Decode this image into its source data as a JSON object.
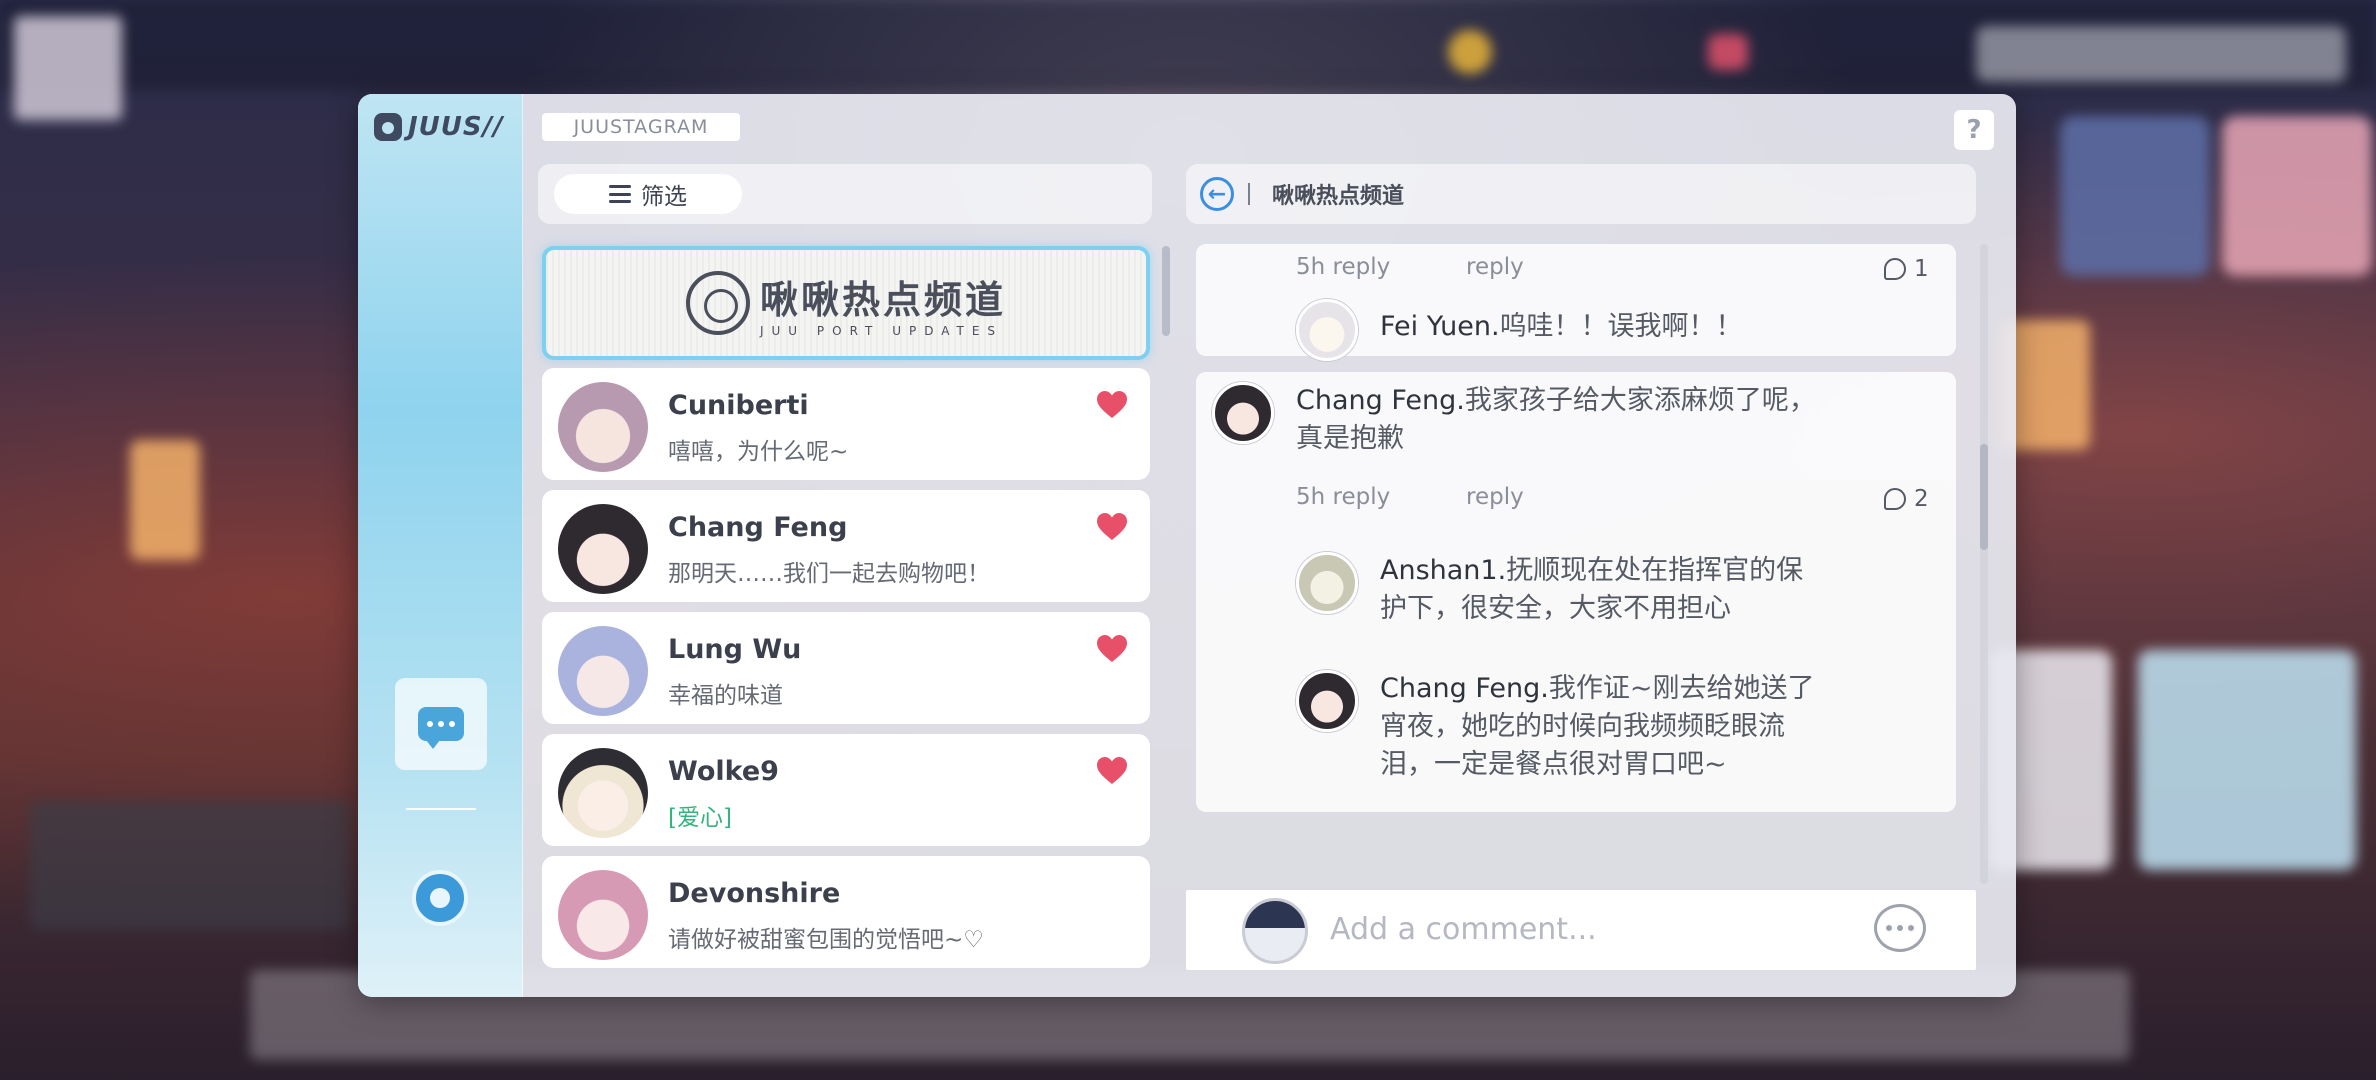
{
  "app": {
    "logo_text": "JUUS//",
    "tag": "JUUSTAGRAM",
    "help": "?"
  },
  "filter": {
    "label": "筛选"
  },
  "channel_card": {
    "title": "啾啾热点频道",
    "subtitle": "JUU PORT UPDATES"
  },
  "friends": [
    {
      "name": "Cuniberti",
      "message": "嘻嘻，为什么呢~",
      "liked": true,
      "avatar_color": "#b79ab0"
    },
    {
      "name": "Chang Feng",
      "message": "那明天……我们一起去购物吧！",
      "liked": true,
      "avatar_color": "#2f2a30"
    },
    {
      "name": "Lung Wu",
      "message": "幸福的味道",
      "liked": true,
      "avatar_color": "#a9b3de"
    },
    {
      "name": "Wolke9",
      "message": "[爱心]",
      "liked": true,
      "avatar_color": "#f0e6d4"
    },
    {
      "name": "Devonshire",
      "message": "请做好被甜蜜包围的觉悟吧~♡",
      "liked": false,
      "avatar_color": "#d79ab4"
    }
  ],
  "header": {
    "channel_title": "啾啾热点频道"
  },
  "feed": {
    "post1": {
      "time": "5h",
      "reply_label": "reply",
      "reply_label2": "reply",
      "reply_count": "1",
      "replies": [
        {
          "author": "Fei Yuen.",
          "text": "呜哇！！误我啊！！"
        }
      ]
    },
    "post2": {
      "author": "Chang Feng.",
      "text_line1": "我家孩子给大家添麻烦了呢，",
      "text_line2": "真是抱歉",
      "time": "5h",
      "reply_label": "reply",
      "reply_label2": "reply",
      "reply_count": "2",
      "replies": [
        {
          "author": "Anshan1.",
          "line1": "抚顺现在处在指挥官的保",
          "line2": "护下，很安全，大家不用担心"
        },
        {
          "author": "Chang Feng.",
          "line1": "我作证~刚去给她送了",
          "line2": "宵夜，她吃的时候向我频频眨眼流",
          "line3": "泪，一定是餐点很对胃口吧~"
        }
      ]
    }
  },
  "comment": {
    "placeholder": "Add a comment..."
  },
  "colors": {
    "accent_blue": "#3b8fe0",
    "heart_red": "#e8506a",
    "highlight_border": "#7fd0f0"
  }
}
